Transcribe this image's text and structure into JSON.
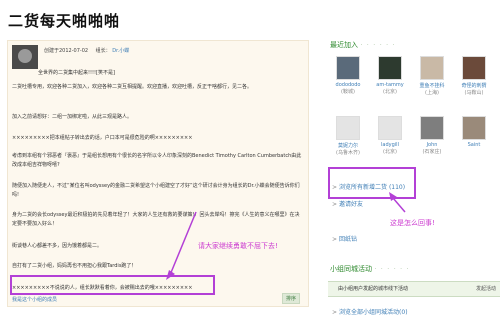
{
  "page": {
    "title": "二货每天啪啪啪"
  },
  "post": {
    "meta_prefix": "创建于2012-07-02",
    "meta_leader_label": "组长：",
    "meta_leader_name": "Dr.小蝶",
    "lines": [
      "全世界的二货集中起来!!!![笑不是]",
      "二货吐槽专用，欢迎各种二货加入，欢迎各种二货互相提醒。欢迎直播，欢迎吐槽，反正干啥都行，见二各。",
      "加入之前请想好：二组一加绑定啦，从此三观是路人。",
      "×××××××××把本组帖子转出去的话，户口本可是很危险的啊×××××××××",
      "考虑到本组有个邪恶者『褒恶』于是组长想用有个很长的名字所以令人印象深刻的Benedict Timothy Carlton Cumberbatch由此改成本组吉祥物呀嘻?",
      "随便加入随便走人，不过“某位名叫odyssey的金融二货希望这个小组建空了才好”这个研讨会计身为组长的Dr.小蝶会随便告诉你们吗!",
      "身为二货的会长odyssey最近积极拍的先见着年轻了！大家的人生还有救的要谋策!！回头去岸吗！擦完《人生的意义在哪里》在决定要不要加入好么！",
      "街谈巷人心都差不多，因为饿着都是二。",
      "自打有了二货小组，妈妈再也不用担心我跟Tardis跑了！",
      "×××××××××不说说的人，组长默默看着你，会被赐出去的哦×××××××××"
    ],
    "pink_note": "请大家继续勇敢不屈下去!",
    "footer_link": "我是这个小组的成员",
    "sort_button": "排序"
  },
  "sidebar": {
    "recent_title": "最近加入",
    "dots": "· · · · · ·",
    "members": [
      {
        "name": "dodododo",
        "city": "(鞍城)"
      },
      {
        "name": "am-tammy",
        "city": "(北京)"
      },
      {
        "name": "重鱼不挂科",
        "city": "(上海)"
      },
      {
        "name": "奇怪的刺猬",
        "city": "(马鞍山)"
      },
      {
        "name": "莫妮力尔",
        "city": "(乌鲁木齐)"
      },
      {
        "name": "ladygill",
        "city": "(北京)"
      },
      {
        "name": "John",
        "city": "(石家庄)"
      },
      {
        "name": "Saint",
        "city": ""
      }
    ],
    "browse_all": "浏览所有新增二货 (110)",
    "invite": "邀请好友",
    "back": "回纸钻",
    "pink_note": "这是怎么回事!",
    "activity_title": "小组同城活动",
    "activity_row_label": "由小组用户发起的城市线下活动",
    "activity_row_action": "发起活动",
    "activity_more": "浏览全部小组同城活动(0)"
  },
  "colors": {
    "highlight": "#b340d6",
    "pink_text": "#cc3bd0",
    "link": "#3d7db5",
    "accent_green": "#2f8a2f"
  },
  "icons": {
    "browse_arrow": "arrow-right-icon"
  }
}
